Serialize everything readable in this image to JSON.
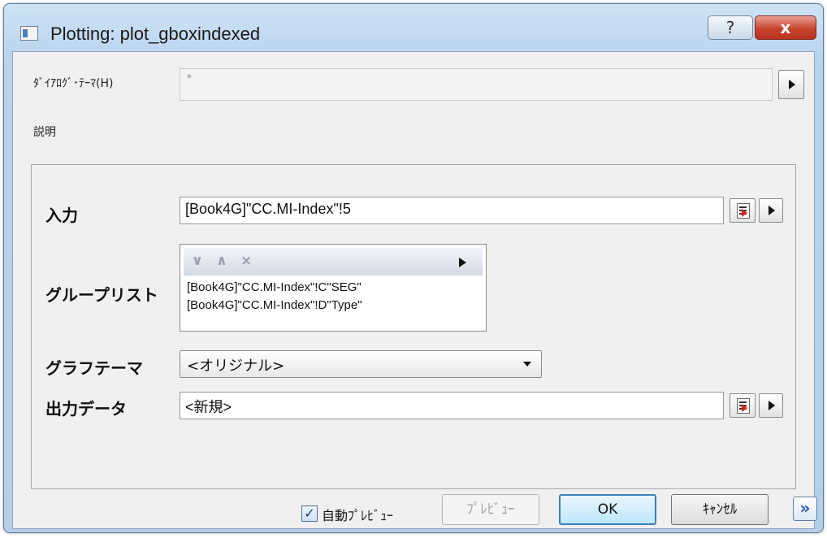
{
  "window": {
    "title": "Plotting: plot_gboxindexed",
    "help_glyph": "?",
    "close_glyph": "x"
  },
  "dialog_theme": {
    "label": "ﾀﾞｲｱﾛｸﾞ･ﾃｰﾏ(H)",
    "value": "*"
  },
  "description": {
    "label": "説明"
  },
  "form": {
    "input": {
      "label": "入力",
      "value": "[Book4G]\"CC.MI-Index\"!5"
    },
    "group_list": {
      "label": "グループリスト",
      "toolbar": {
        "down": "∨",
        "up": "∧",
        "remove": "×"
      },
      "items": [
        "[Book4G]\"CC.MI-Index\"!C\"SEG\"",
        "[Book4G]\"CC.MI-Index\"!D\"Type\""
      ]
    },
    "graph_theme": {
      "label": "グラフテーマ",
      "selected": "<オリジナル>"
    },
    "output_data": {
      "label": "出力データ",
      "value": "<新規>"
    }
  },
  "footer": {
    "auto_preview_label": "自動ﾌﾟﾚﾋﾞｭｰ",
    "auto_preview_checked": true,
    "checkmark": "✓",
    "preview_label": "ﾌﾟﾚﾋﾞｭｰ",
    "ok_label": "OK",
    "cancel_label": "ｷｬﾝｾﾙ",
    "expand_glyph": "»"
  }
}
